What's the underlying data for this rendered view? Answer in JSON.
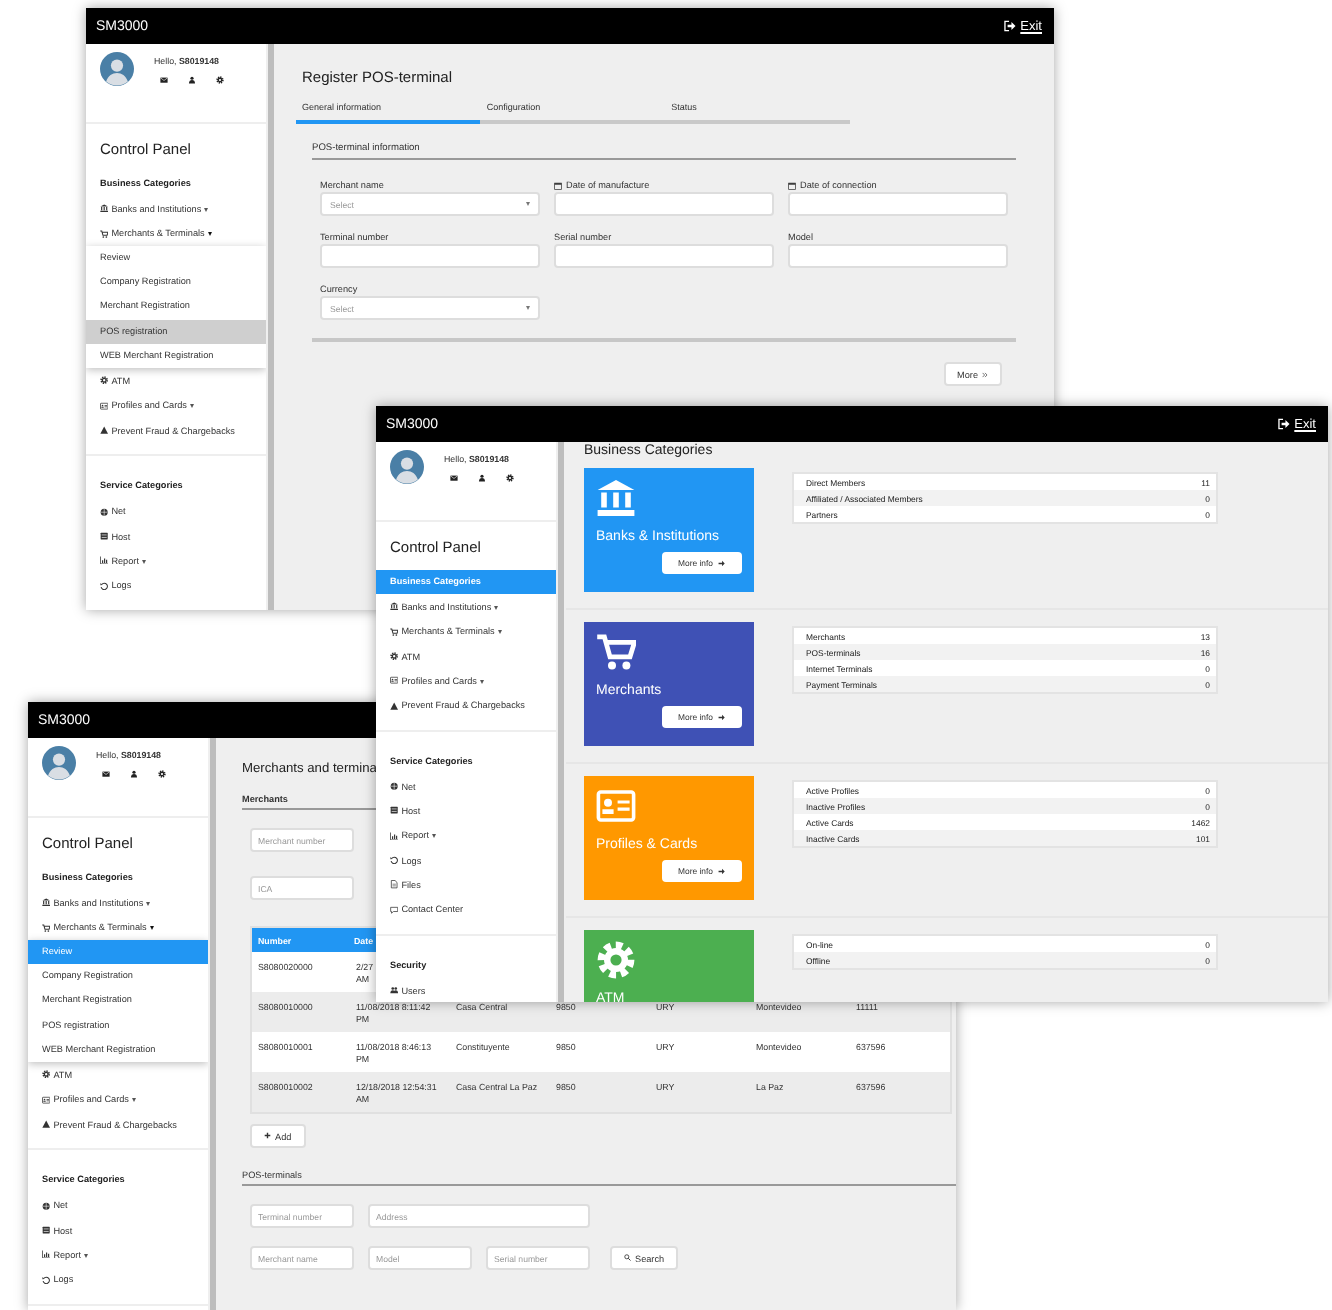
{
  "windows": [
    {
      "kind": "register",
      "app_title": "SM3000",
      "exit": "Exit",
      "sidebar": {
        "greeting": "Hello, **S8019148**",
        "title": "Control Panel",
        "sections": [
          {
            "heading": "Business Categories",
            "selected": false,
            "items": [
              {
                "label": "Banks and Institutions",
                "caret": "▾",
                "expanded": false
              },
              {
                "label": "Merchants & Terminals",
                "caret": "▾",
                "expanded": true,
                "children": [
                  {
                    "label": "Review",
                    "selected": false
                  },
                  {
                    "label": "Company Registration",
                    "selected": false
                  },
                  {
                    "label": "Merchant Registration",
                    "selected": false
                  },
                  {
                    "label": "POS registration",
                    "selected": true
                  },
                  {
                    "label": "WEB Merchant Registration",
                    "selected": false
                  }
                ]
              },
              {
                "label": "ATM"
              },
              {
                "label": "Profiles and Cards",
                "caret": "▾",
                "expanded": false
              },
              {
                "label": "Prevent Fraud & Chargebacks"
              }
            ]
          },
          {
            "heading": "Service Categories",
            "selected": false,
            "items": [
              {
                "label": "Net"
              },
              {
                "label": "Host"
              },
              {
                "label": "Report",
                "caret": "▾",
                "expanded": false
              },
              {
                "label": "Logs"
              }
            ]
          }
        ]
      },
      "content": {
        "title": "Register POS-terminal",
        "tabs": [
          {
            "label": "General information",
            "selected": true
          },
          {
            "label": "Configuration",
            "selected": false
          },
          {
            "label": "Status",
            "selected": false
          }
        ],
        "section": "POS-terminal information",
        "fields": [
          {
            "kind": "select",
            "label": "Merchant name",
            "placeholder": "Select"
          },
          {
            "kind": "date",
            "label": "Date of manufacture"
          },
          {
            "kind": "date",
            "label": "Date of connection"
          },
          {
            "kind": "text",
            "label": "Terminal number"
          },
          {
            "kind": "text",
            "label": "Serial number"
          },
          {
            "kind": "text",
            "label": "Model"
          },
          {
            "kind": "select",
            "label": "Currency",
            "placeholder": "Select"
          }
        ],
        "more_button": "More"
      }
    },
    {
      "kind": "dashboard",
      "app_title": "SM3000",
      "exit": "Exit",
      "sidebar": {
        "greeting": "Hello, **S8019148**",
        "title": "Control Panel",
        "sections": [
          {
            "heading": "Business Categories",
            "selected": true,
            "items": [
              {
                "label": "Banks and Institutions",
                "caret": "▾",
                "expanded": false
              },
              {
                "label": "Merchants & Terminals",
                "caret": "▾",
                "expanded": false
              },
              {
                "label": "ATM"
              },
              {
                "label": "Profiles and Cards",
                "caret": "▾",
                "expanded": false
              },
              {
                "label": "Prevent Fraud & Chargebacks"
              }
            ]
          },
          {
            "heading": "Service Categories",
            "selected": false,
            "items": [
              {
                "label": "Net"
              },
              {
                "label": "Host"
              },
              {
                "label": "Report",
                "caret": "▾",
                "expanded": false
              },
              {
                "label": "Logs"
              },
              {
                "label": "Files"
              },
              {
                "label": "Contact Center"
              }
            ]
          },
          {
            "heading": "Security",
            "selected": false,
            "items": [
              {
                "label": "Users"
              }
            ]
          }
        ]
      },
      "content": {
        "title": "Business Categories",
        "tiles": [
          {
            "title": "Banks & Institutions",
            "color": "#2196f3",
            "button": "More info",
            "stats": [
              {
                "label": "Direct Members",
                "value": "11"
              },
              {
                "label": "Affiliated / Associated Members",
                "value": "0"
              },
              {
                "label": "Partners",
                "value": "0"
              }
            ]
          },
          {
            "title": "Merchants",
            "color": "#3f51b5",
            "button": "More info",
            "stats": [
              {
                "label": "Merchants",
                "value": "13"
              },
              {
                "label": "POS-terminals",
                "value": "16"
              },
              {
                "label": "Internet Terminals",
                "value": "0"
              },
              {
                "label": "Payment Terminals",
                "value": "0"
              }
            ]
          },
          {
            "title": "Profiles & Cards",
            "color": "#ff9800",
            "button": "More info",
            "stats": [
              {
                "label": "Active Profiles",
                "value": "0"
              },
              {
                "label": "Inactive Profiles",
                "value": "0"
              },
              {
                "label": "Active Cards",
                "value": "1462"
              },
              {
                "label": "Inactive Cards",
                "value": "101"
              }
            ]
          },
          {
            "title": "ATM",
            "color": "#4caf50",
            "stats": [
              {
                "label": "On-line",
                "value": "0"
              },
              {
                "label": "Offline",
                "value": "0"
              }
            ]
          }
        ]
      }
    },
    {
      "kind": "merchants",
      "app_title": "SM3000",
      "sidebar": {
        "greeting": "Hello, **S8019148**",
        "title": "Control Panel",
        "sections": [
          {
            "heading": "Business Categories",
            "selected": false,
            "items": [
              {
                "label": "Banks and Institutions",
                "caret": "▾",
                "expanded": false
              },
              {
                "label": "Merchants & Terminals",
                "caret": "▾",
                "expanded": true,
                "children": [
                  {
                    "label": "Review",
                    "selected": true
                  },
                  {
                    "label": "Company Registration",
                    "selected": false
                  },
                  {
                    "label": "Merchant Registration",
                    "selected": false
                  },
                  {
                    "label": "POS registration",
                    "selected": false
                  },
                  {
                    "label": "WEB Merchant Registration",
                    "selected": false
                  }
                ]
              },
              {
                "label": "ATM"
              },
              {
                "label": "Profiles and Cards",
                "caret": "▾",
                "expanded": false
              },
              {
                "label": "Prevent Fraud & Chargebacks"
              }
            ]
          },
          {
            "heading": "Service Categories",
            "selected": false,
            "items": [
              {
                "label": "Net"
              },
              {
                "label": "Host"
              },
              {
                "label": "Report",
                "caret": "▾",
                "expanded": false
              },
              {
                "label": "Logs"
              }
            ]
          }
        ]
      },
      "content": {
        "title": "Merchants and termina",
        "section": "Merchants",
        "filters": [
          {
            "placeholder": "Merchant number"
          },
          {
            "placeholder": "ICA"
          }
        ],
        "table": {
          "columns": [
            "Number",
            "Date"
          ],
          "rows": [
            [
              "S8080020000",
              "2/27\nAM"
            ],
            [
              "S8080010000",
              "11/08/2018 8:11:42\nPM",
              "Casa Central",
              "9850",
              "URY",
              "Montevideo",
              "11111"
            ],
            [
              "S8080010001",
              "11/08/2018 8:46:13\nPM",
              "Constituyente",
              "9850",
              "URY",
              "Montevideo",
              "637596"
            ],
            [
              "S8080010002",
              "12/18/2018 12:54:31\nAM",
              "Casa Central La Paz",
              "9850",
              "URY",
              "La Paz",
              "637596"
            ]
          ]
        },
        "add_button": "Add",
        "pos_section": "POS-terminals",
        "pos_filters": [
          [
            {
              "kind": "short",
              "placeholder": "Terminal number"
            },
            {
              "kind": "wide",
              "placeholder": "Address"
            }
          ],
          [
            {
              "kind": "short",
              "placeholder": "Merchant name"
            },
            {
              "kind": "short",
              "placeholder": "Model"
            },
            {
              "kind": "short",
              "placeholder": "Serial number"
            }
          ]
        ],
        "search_button": "Search"
      }
    }
  ]
}
